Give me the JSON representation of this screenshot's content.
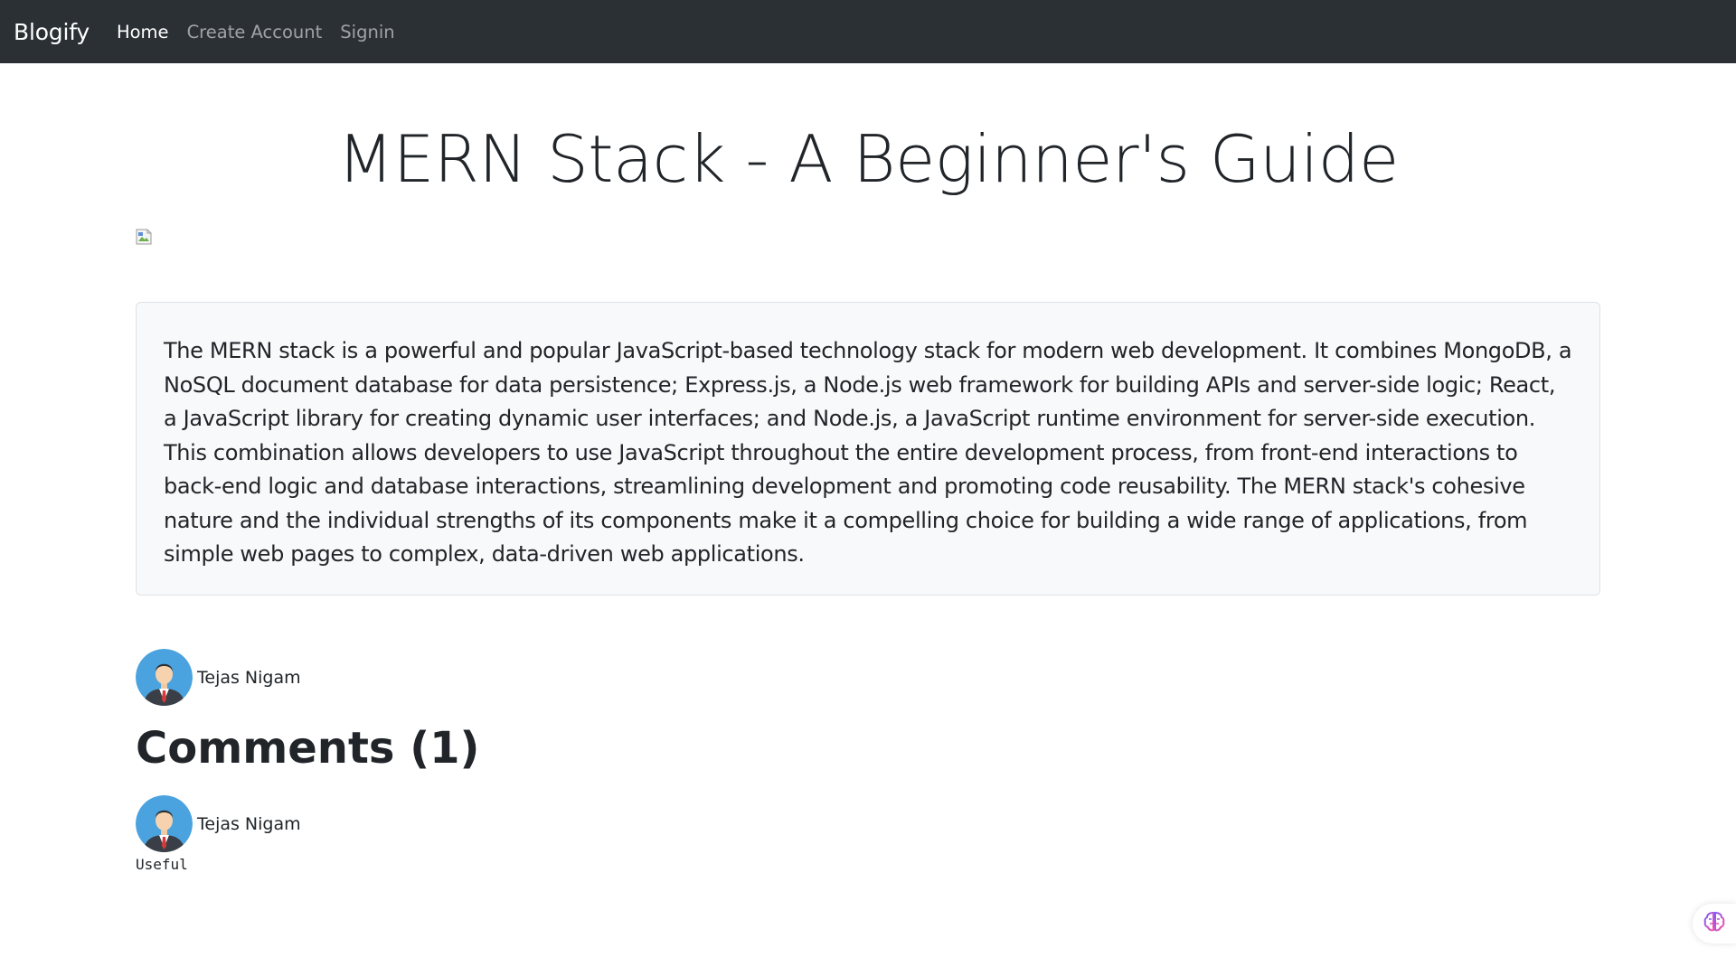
{
  "navbar": {
    "brand": "Blogify",
    "links": [
      {
        "label": "Home",
        "active": true
      },
      {
        "label": "Create Account",
        "active": false
      },
      {
        "label": "Signin",
        "active": false
      }
    ]
  },
  "post": {
    "title": "MERN Stack - A Beginner's Guide",
    "cover_image_icon": "broken-image-icon",
    "body": "The MERN stack is a powerful and popular JavaScript-based technology stack for modern web development. It combines MongoDB, a NoSQL document database for data persistence; Express.js, a Node.js web framework for building APIs and server-side logic; React, a JavaScript library for creating dynamic user interfaces; and Node.js, a JavaScript runtime environment for server-side execution. This combination allows developers to use JavaScript throughout the entire development process, from front-end interactions to back-end logic and database interactions, streamlining development and promoting code reusability. The MERN stack's cohesive nature and the individual strengths of its components make it a compelling choice for building a wide range of applications, from simple web pages to complex, data-driven web applications.",
    "author": {
      "name": "Tejas Nigam",
      "avatar_icon": "user-avatar-icon"
    }
  },
  "comments": {
    "heading": "Comments (1)",
    "items": [
      {
        "author": "Tejas Nigam",
        "avatar_icon": "user-avatar-icon",
        "text": "Useful"
      }
    ]
  },
  "extension_widget": {
    "icon": "brain-icon"
  },
  "colors": {
    "navbar_bg": "#2b3035",
    "content_bg": "#f8f9fa",
    "content_border": "#dee2e6",
    "avatar_bg": "#4aa3df",
    "text": "#212529"
  }
}
